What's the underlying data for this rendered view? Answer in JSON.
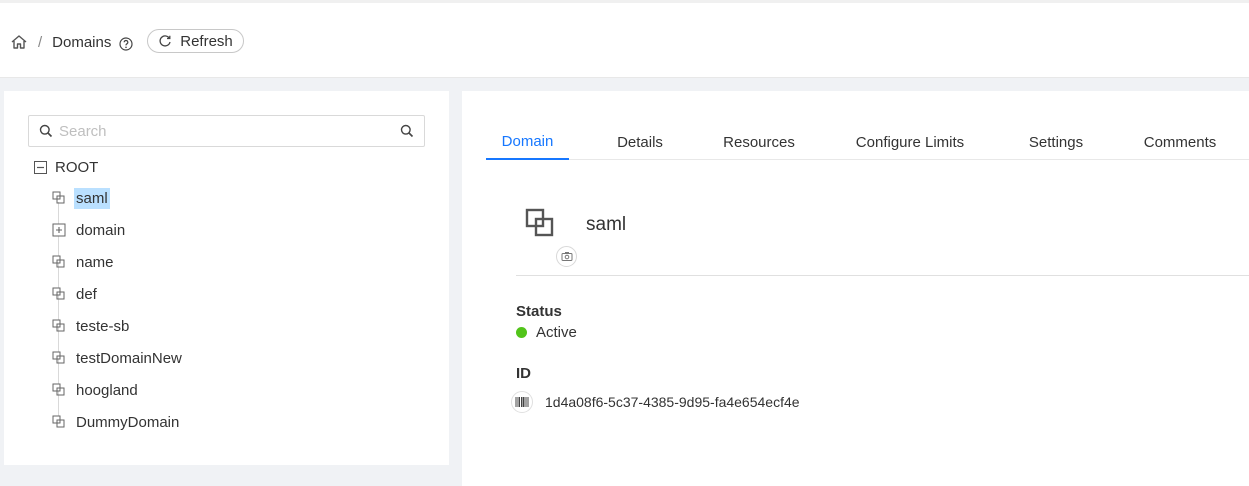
{
  "breadcrumb": {
    "home_icon": "home-icon",
    "current": "Domains",
    "help_icon": "question-circle-icon"
  },
  "refresh_button": {
    "label": "Refresh",
    "icon": "reload-icon"
  },
  "search": {
    "placeholder": "Search",
    "icon": "search-icon"
  },
  "tree": {
    "root": {
      "label": "ROOT",
      "expanded": true
    },
    "items": [
      {
        "label": "saml",
        "selected": true
      },
      {
        "label": "domain",
        "expandable": true
      },
      {
        "label": "name"
      },
      {
        "label": "def"
      },
      {
        "label": "teste-sb"
      },
      {
        "label": "testDomainNew"
      },
      {
        "label": "hoogland"
      },
      {
        "label": "DummyDomain"
      }
    ]
  },
  "tabs": [
    {
      "label": "Domain",
      "active": true
    },
    {
      "label": "Details"
    },
    {
      "label": "Resources"
    },
    {
      "label": "Configure Limits"
    },
    {
      "label": "Settings"
    },
    {
      "label": "Comments"
    }
  ],
  "detail": {
    "name": "saml",
    "icon": "block-icon",
    "status_label": "Status",
    "status_value": "Active",
    "status_color": "#52c41a",
    "id_label": "ID",
    "id_value": "1d4a08f6-5c37-4385-9d95-fa4e654ecf4e"
  },
  "colors": {
    "accent": "#1677ff",
    "selected_bg": "#bae0ff"
  }
}
